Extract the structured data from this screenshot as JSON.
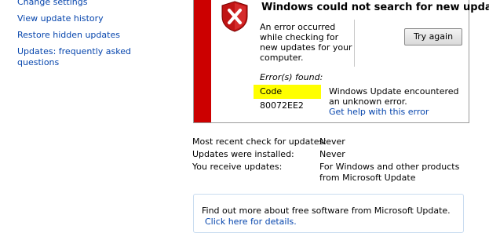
{
  "sidebar": {
    "links": [
      "Change settings",
      "View update history",
      "Restore hidden updates",
      "Updates: frequently asked",
      "questions"
    ]
  },
  "error_panel": {
    "title": "Windows could not search for new updates",
    "description": "An error occurred while checking for new updates for your computer.",
    "try_again_label": "Try again",
    "errors_found_label": "Error(s) found:",
    "error_code": "Code 80072EE2",
    "error_message": "Windows Update encountered an unknown error.",
    "help_link": "Get help with this error",
    "strip_color": "#cc0000",
    "highlight_color": "#ffff00"
  },
  "status": {
    "rows": [
      {
        "label": "Most recent check for updates:",
        "value": "Never"
      },
      {
        "label": "Updates were installed:",
        "value": "Never"
      },
      {
        "label": "You receive updates:",
        "value": "For Windows and other products from Microsoft Update"
      }
    ]
  },
  "promo": {
    "text": "Find out more about free software from Microsoft Update.",
    "link": "Click here for details."
  },
  "icons": {
    "error": "shield-x-icon"
  }
}
